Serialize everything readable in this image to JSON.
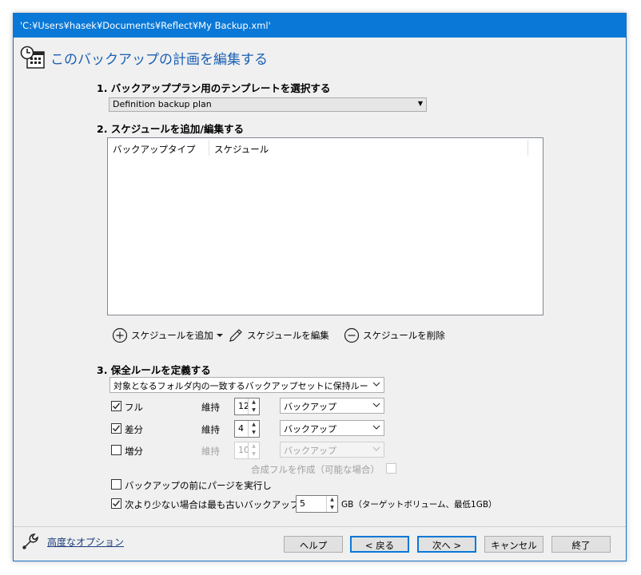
{
  "window": {
    "title": "'C:¥Users¥hasek¥Documents¥Reflect¥My Backup.xml'",
    "heading": "このバックアップの計画を編集する"
  },
  "step1": {
    "label": "1. バックアッププラン用のテンプレートを選択する",
    "template_value": "Definition backup plan"
  },
  "step2": {
    "label": "2. スケジュールを追加/編集する",
    "columns": [
      "バックアップタイプ",
      "スケジュール"
    ],
    "actions": {
      "add": "スケジュールを追加",
      "edit": "スケジュールを編集",
      "delete": "スケジュールを削除"
    }
  },
  "step3": {
    "label": "3. 保全ルールを定義する",
    "rule_select": "対象となるフォルダ内の一致するバックアップセットに保持ルールを適用",
    "rows": [
      {
        "label": "フル",
        "checked": true,
        "keep_label": "維持",
        "count": "12",
        "unit": "バックアップ"
      },
      {
        "label": "差分",
        "checked": true,
        "keep_label": "維持",
        "count": "4",
        "unit": "バックアップ"
      },
      {
        "label": "増分",
        "checked": false,
        "keep_label": "維持",
        "count": "10",
        "unit": "バックアップ"
      }
    ],
    "synthetic_full": "合成フルを作成（可能な場合）",
    "purge_before": "バックアップの前にパージを実行し",
    "oldest_prefix": "次より少ない場合は最も古いバックアップセット",
    "oldest_value": "5",
    "oldest_suffix": "GB（ターゲットボリューム、最低1GB）"
  },
  "footer": {
    "advanced": "高度なオプション",
    "buttons": {
      "help": "ヘルプ",
      "back": "< 戻る",
      "next": "次へ >",
      "cancel": "キャンセル",
      "finish": "終了"
    }
  }
}
